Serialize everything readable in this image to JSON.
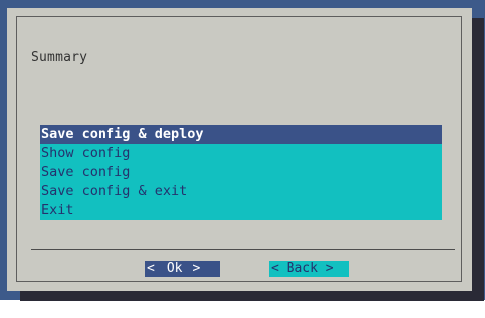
{
  "dialog": {
    "title": "Summary"
  },
  "menu": {
    "items": [
      {
        "label": "Save config & deploy",
        "selected": true
      },
      {
        "label": "Show config",
        "selected": false
      },
      {
        "label": "Save config",
        "selected": false
      },
      {
        "label": "Save config & exit",
        "selected": false
      },
      {
        "label": "Exit",
        "selected": false
      }
    ]
  },
  "buttons": {
    "ok": {
      "left": "<",
      "label": "Ok",
      "right": ">"
    },
    "back": {
      "left": "<",
      "label": "Back",
      "right": ">"
    }
  },
  "colors": {
    "background": "#3d5a8a",
    "dialog": "#c9c9c2",
    "menu_bg": "#12c0c0",
    "selected_bg": "#3a5288",
    "selected_fg": "#ffffff",
    "menu_fg": "#25326d"
  }
}
